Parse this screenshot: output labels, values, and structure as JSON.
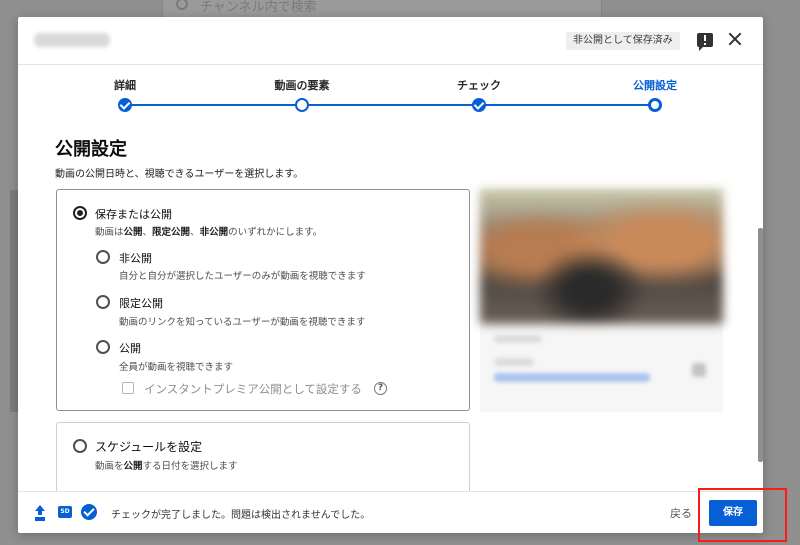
{
  "background": {
    "search_placeholder": "チャンネル内で検索"
  },
  "header": {
    "draft_badge": "非公開として保存済み"
  },
  "stepper": {
    "steps": [
      {
        "label": "詳細",
        "state": "done"
      },
      {
        "label": "動画の要素",
        "state": "open"
      },
      {
        "label": "チェック",
        "state": "done"
      },
      {
        "label": "公開設定",
        "state": "current"
      }
    ]
  },
  "visibility": {
    "title": "公開設定",
    "description": "動画の公開日時と、視聴できるユーザーを選択します。",
    "save_or_publish": {
      "label": "保存または公開",
      "desc_parts": [
        "動画は",
        "公開",
        "、",
        "限定公開",
        "、",
        "非公開",
        "のいずれかにします。"
      ]
    },
    "options": [
      {
        "label": "非公開",
        "desc": "自分と自分が選択したユーザーのみが動画を視聴できます"
      },
      {
        "label": "限定公開",
        "desc": "動画のリンクを知っているユーザーが動画を視聴できます"
      },
      {
        "label": "公開",
        "desc": "全員が動画を視聴できます"
      }
    ],
    "premiere_label": "インスタントプレミア公開として設定する",
    "help_glyph": "?",
    "schedule": {
      "label": "スケジュールを設定",
      "desc_parts": [
        "動画を",
        "公開",
        "する日付を選択します"
      ]
    }
  },
  "footer": {
    "hd_glyph": "SD",
    "status": "チェックが完了しました。問題は検出されませんでした。",
    "back_label": "戻る",
    "save_label": "保存"
  },
  "colors": {
    "accent": "#065fd4",
    "highlight": "#ff1a1a"
  }
}
